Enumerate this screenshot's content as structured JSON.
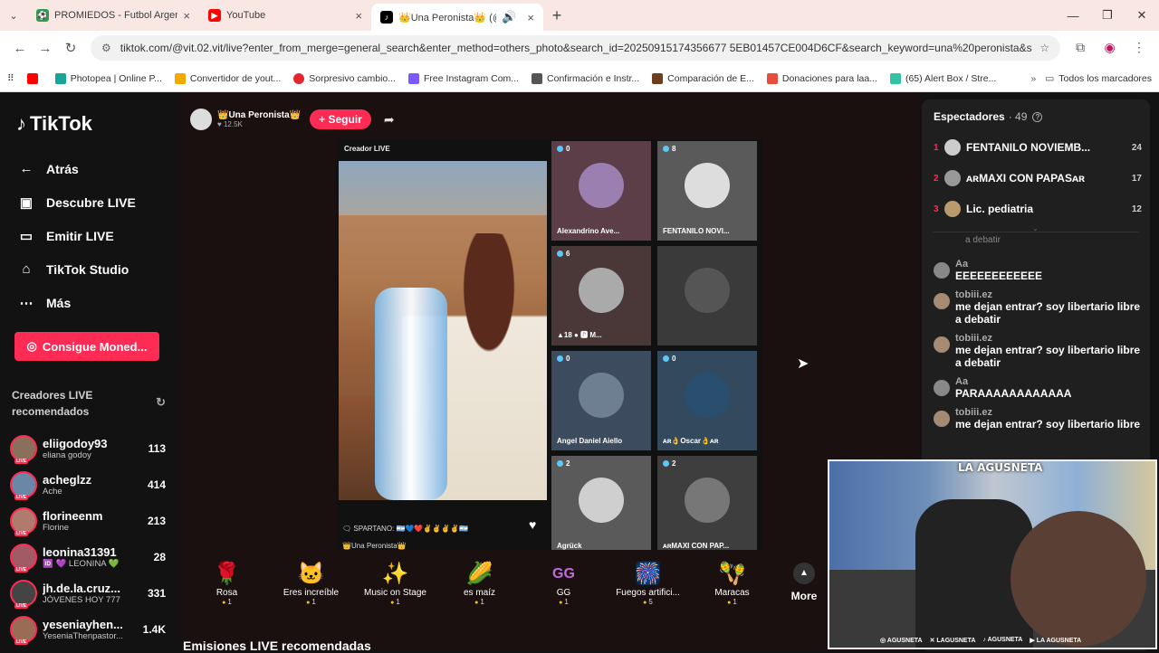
{
  "browser": {
    "tabs": [
      {
        "title": "PROMIEDOS - Futbol Argentino",
        "favicon_color": "#2e9d4a",
        "favicon_glyph": "⚽"
      },
      {
        "title": "YouTube",
        "favicon_color": "#ff0000",
        "favicon_glyph": "▶"
      },
      {
        "title": "👑Una Peronista👑 (@vit.0",
        "favicon_color": "#000000",
        "favicon_glyph": "♪"
      }
    ],
    "url": "tiktok.com/@vit.02.vit/live?enter_from_merge=general_search&enter_method=others_photo&search_id=20250915174356677 5EB01457CE004D6CF&search_keyword=una%20peronista&search_result_id...",
    "bookmarks": [
      {
        "label": "",
        "color": "#ff0000"
      },
      {
        "label": "Photopea | Online P...",
        "color": "#18a497"
      },
      {
        "label": "Convertidor de yout...",
        "color": "#f2a900"
      },
      {
        "label": "Sorpresivo cambio...",
        "color": "#e3262e"
      },
      {
        "label": "Free Instagram Com...",
        "color": "#7a5af8"
      },
      {
        "label": "Confirmación e Instr...",
        "color": "#555555"
      },
      {
        "label": "Comparación de E...",
        "color": "#6b3e1e"
      },
      {
        "label": "Donaciones para laa...",
        "color": "#e84c3d"
      },
      {
        "label": "(65) Alert Box / Stre...",
        "color": "#31c3a2"
      }
    ],
    "all_bookmarks": "Todos los marcadores"
  },
  "sidebar": {
    "logo": "TikTok",
    "nav": [
      {
        "label": "Atrás",
        "icon": "back-icon",
        "glyph": "←"
      },
      {
        "label": "Descubre LIVE",
        "icon": "live-discover-icon",
        "glyph": "▣"
      },
      {
        "label": "Emitir LIVE",
        "icon": "camera-icon",
        "glyph": "▭"
      },
      {
        "label": "TikTok Studio",
        "icon": "home-icon",
        "glyph": "⌂"
      },
      {
        "label": "Más",
        "icon": "more-icon",
        "glyph": "⋯"
      }
    ],
    "coins_button": "Consigue Moned...",
    "recommended_title": "Creadores LIVE recomendados",
    "creators": [
      {
        "name": "eliigodoy93",
        "sub": "eliana godoy",
        "count": "113",
        "color": "#8a6f5c"
      },
      {
        "name": "acheglzz",
        "sub": "Ache",
        "count": "414",
        "color": "#6a87a8"
      },
      {
        "name": "florineenm",
        "sub": "Florine",
        "count": "213",
        "color": "#b07a6e"
      },
      {
        "name": "leonina31391",
        "sub": "🆔 💜 LEONINA 💚",
        "count": "28",
        "color": "#a25b64"
      },
      {
        "name": "jh.de.la.cruz...",
        "sub": "JÓVENES HOY 777",
        "count": "331",
        "color": "#444444"
      },
      {
        "name": "yeseniayhen...",
        "sub": "YeseniaThenpastor...",
        "count": "1.4K",
        "color": "#9a6b55"
      }
    ]
  },
  "stream": {
    "host_name": "👑Una Peronista👑",
    "host_likes": "♥ 12.5K",
    "follow_label": "+ Seguir",
    "creator_label": "Creador LIVE",
    "comment_line": "🗨 SPARTANO: 🇦🇷💙❤️✌️✌️✌️✌️🇦🇷",
    "host_footer": "👑Una Peronista👑",
    "guests": [
      {
        "name": "Alexandrino Ave...",
        "count": "0",
        "color": "#5c3e48"
      },
      {
        "name": "FENTANILO NOVI...",
        "count": "8",
        "color": "#5a5a5a"
      },
      {
        "name": "▲18 ● 🅿 M...",
        "count": "6",
        "color": "#4a3838"
      },
      {
        "name": "",
        "count": "",
        "color": "#3a3a3a"
      },
      {
        "name": "Angel Daniel Aiello",
        "count": "0",
        "color": "#3d4b5e"
      },
      {
        "name": "ᴀʀ👌Oscar👌ᴀʀ",
        "count": "0",
        "color": "#33495e"
      },
      {
        "name": "Agrück",
        "count": "2",
        "color": "#5a5a5a"
      },
      {
        "name": "ᴀʀMAXI CON PAP...",
        "count": "2",
        "color": "#3e3e3e"
      }
    ],
    "gifts": [
      {
        "name": "Rosa",
        "price": "1",
        "icon": "rose-icon",
        "glyph": "🌹"
      },
      {
        "name": "Eres increíble",
        "price": "1",
        "icon": "cat-icon",
        "glyph": "🐱"
      },
      {
        "name": "Music on Stage",
        "price": "1",
        "icon": "star-burst-icon",
        "glyph": "✨"
      },
      {
        "name": "es maíz",
        "price": "1",
        "icon": "corn-icon",
        "glyph": "🌽"
      },
      {
        "name": "GG",
        "price": "1",
        "icon": "gg-icon",
        "glyph": "GG"
      },
      {
        "name": "Fuegos artifici...",
        "price": "5",
        "icon": "firework-icon",
        "glyph": "🎆"
      },
      {
        "name": "Maracas",
        "price": "1",
        "icon": "maracas-icon",
        "glyph": "🪇"
      }
    ],
    "more_label": "More",
    "recommended_live": "Emisiones LIVE recomendadas"
  },
  "right_panel": {
    "title": "Espectadores",
    "count": "· 49",
    "viewers": [
      {
        "rank": "1",
        "name": "FENTANILO NOVIEMB...",
        "score": "24"
      },
      {
        "rank": "2",
        "name": "ᴀʀMAXI CON PAPASᴀʀ",
        "score": "17"
      },
      {
        "rank": "3",
        "name": "Lic. pediatria",
        "score": "12"
      }
    ],
    "clipped": "a debatir",
    "chat": [
      {
        "user": "Aa",
        "text": "EEEEEEEEEEEE"
      },
      {
        "user": "tobiii.ez",
        "text": "me dejan entrar? soy libertario libre a debatir"
      },
      {
        "user": "tobiii.ez",
        "text": "me dejan entrar? soy libertario libre a debatir"
      },
      {
        "user": "Aa",
        "text": "PARAAAAAAAAAAAA"
      },
      {
        "user": "tobiii.ez",
        "text": "me dejan entrar? soy libertario libre"
      }
    ]
  },
  "webcam": {
    "badge": "LA AGUSNETA",
    "socials": [
      "◎ AGUSNETA",
      "✕ LAGUSNETA",
      "♪ AGUSNETA",
      "▶ LA AGUSNETA"
    ]
  }
}
